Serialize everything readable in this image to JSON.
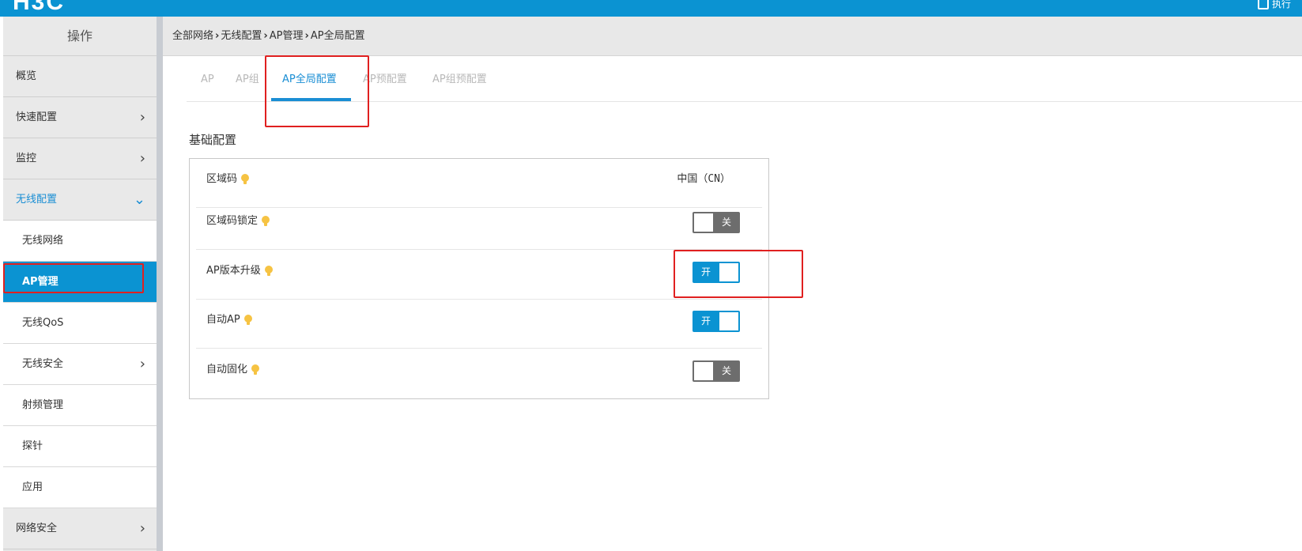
{
  "header": {
    "logo": "H3C",
    "right_label": "执行"
  },
  "sidebar": {
    "title": "操作",
    "items": [
      {
        "label": "概览",
        "type": "group",
        "chevron": ""
      },
      {
        "label": "快速配置",
        "type": "group",
        "chevron": "›"
      },
      {
        "label": "监控",
        "type": "group",
        "chevron": "›"
      },
      {
        "label": "无线配置",
        "type": "group-open",
        "chevron": "⌄"
      },
      {
        "label": "无线网络",
        "type": "sub",
        "chevron": ""
      },
      {
        "label": "AP管理",
        "type": "sub-selected",
        "chevron": ""
      },
      {
        "label": "无线QoS",
        "type": "sub",
        "chevron": ""
      },
      {
        "label": "无线安全",
        "type": "sub",
        "chevron": "›"
      },
      {
        "label": "射频管理",
        "type": "sub",
        "chevron": ""
      },
      {
        "label": "探针",
        "type": "sub",
        "chevron": ""
      },
      {
        "label": "应用",
        "type": "sub",
        "chevron": ""
      },
      {
        "label": "网络安全",
        "type": "group",
        "chevron": "›"
      }
    ]
  },
  "breadcrumb": {
    "items": [
      "全部网络",
      "无线配置",
      "AP管理",
      "AP全局配置"
    ],
    "separator": "›"
  },
  "tabs": [
    {
      "label": "AP",
      "active": false
    },
    {
      "label": "AP组",
      "active": false
    },
    {
      "label": "AP全局配置",
      "active": true
    },
    {
      "label": "AP预配置",
      "active": false
    },
    {
      "label": "AP组预配置",
      "active": false
    }
  ],
  "section": {
    "title": "基础配置"
  },
  "settings": [
    {
      "label": "区域码",
      "value": "中国（CN）",
      "kind": "text"
    },
    {
      "label": "区域码锁定",
      "state": "关",
      "kind": "toggle-off"
    },
    {
      "label": "AP版本升级",
      "state": "开",
      "kind": "toggle-on"
    },
    {
      "label": "自动AP",
      "state": "开",
      "kind": "toggle-on"
    },
    {
      "label": "自动固化",
      "state": "关",
      "kind": "toggle-off"
    }
  ],
  "colors": {
    "brand": "#0b93d2",
    "highlight": "#e02020",
    "hint_icon": "#f6c343"
  }
}
